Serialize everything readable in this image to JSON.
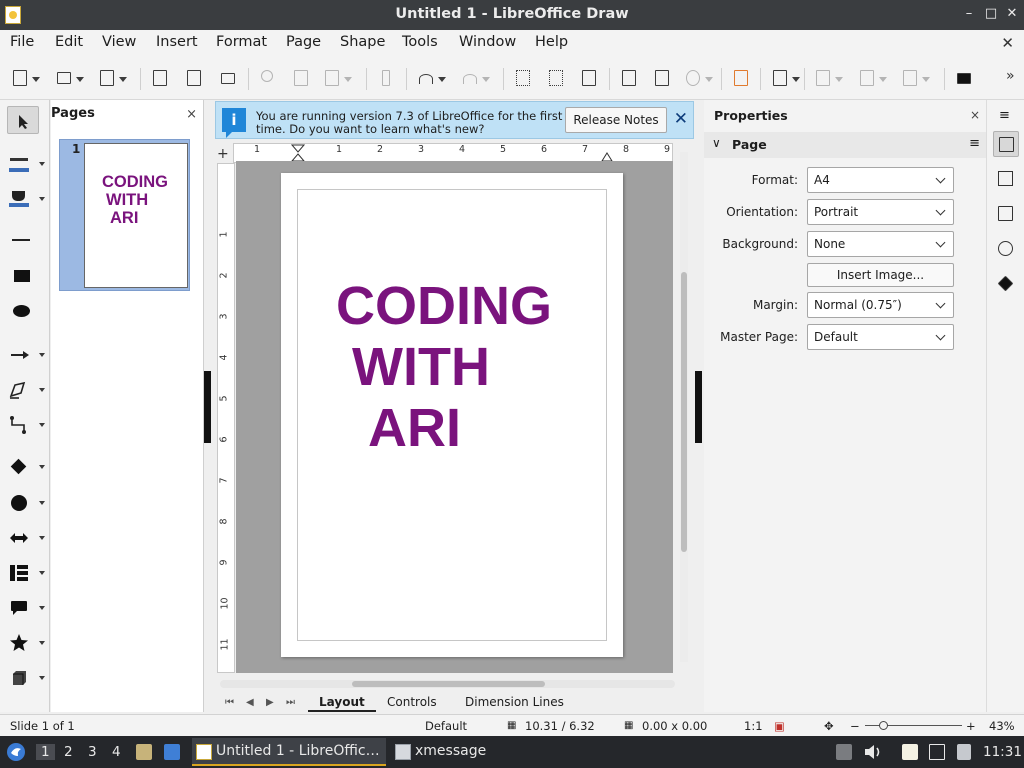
{
  "window": {
    "title": "Untitled 1 - LibreOffice Draw",
    "controls": [
      "–",
      "□",
      "✕"
    ]
  },
  "menubar": {
    "items": [
      "File",
      "Edit",
      "View",
      "Insert",
      "Format",
      "Page",
      "Shape",
      "Tools",
      "Window",
      "Help"
    ],
    "close_symbol": "✕"
  },
  "pages_panel": {
    "title": "Pages",
    "close_symbol": "×",
    "thumbnails": [
      {
        "number": "1",
        "lines": [
          "CODING",
          "WITH",
          "ARI"
        ]
      }
    ]
  },
  "infobar": {
    "icon": "i",
    "message": "You are running version 7.3 of LibreOffice for the first time. Do you want to learn what's new?",
    "button": "Release Notes",
    "close_symbol": "✕"
  },
  "ruler": {
    "corner": "+",
    "h_ticks": [
      "1",
      "1",
      "1",
      "2",
      "3",
      "4",
      "5",
      "6",
      "7",
      "8",
      "9"
    ],
    "v_ticks": [
      "1",
      "2",
      "3",
      "4",
      "5",
      "6",
      "7",
      "8",
      "9",
      "10",
      "11"
    ]
  },
  "document": {
    "lines": [
      "CODING",
      "WITH",
      "ARI"
    ],
    "text_color": "#7a137d"
  },
  "tabs": {
    "nav": [
      "⏮",
      "◀",
      "▶",
      "⏭"
    ],
    "items": [
      "Layout",
      "Controls",
      "Dimension Lines"
    ],
    "active": "Layout"
  },
  "properties": {
    "title": "Properties",
    "close_symbol": "×",
    "section": "Page",
    "fields": [
      {
        "label": "Format:",
        "value": "A4"
      },
      {
        "label": "Orientation:",
        "value": "Portrait"
      },
      {
        "label": "Background:",
        "value": "None"
      },
      {
        "label": "Margin:",
        "value": "Normal (0.75″)"
      },
      {
        "label": "Master Page:",
        "value": "Default"
      }
    ],
    "insert_image_button": "Insert Image..."
  },
  "statusbar": {
    "slide": "Slide 1 of 1",
    "master": "Default",
    "position": "10.31 / 6.32",
    "size": "0.00 x 0.00",
    "scale": "1:1",
    "zoom": "43%",
    "zoom_minus": "−",
    "zoom_plus": "+"
  },
  "taskbar": {
    "workspaces": [
      "1",
      "2",
      "3",
      "4"
    ],
    "active_workspace": "1",
    "tasks": [
      {
        "label": "Untitled 1 - LibreOffic…",
        "active": true
      },
      {
        "label": "xmessage",
        "active": false
      }
    ],
    "clock": "11:31"
  },
  "colors": {
    "accent": "#1f86d8",
    "infobar_bg": "#bfe1f6",
    "text_purple": "#7a137d",
    "taskbar_bg": "#25272b"
  }
}
